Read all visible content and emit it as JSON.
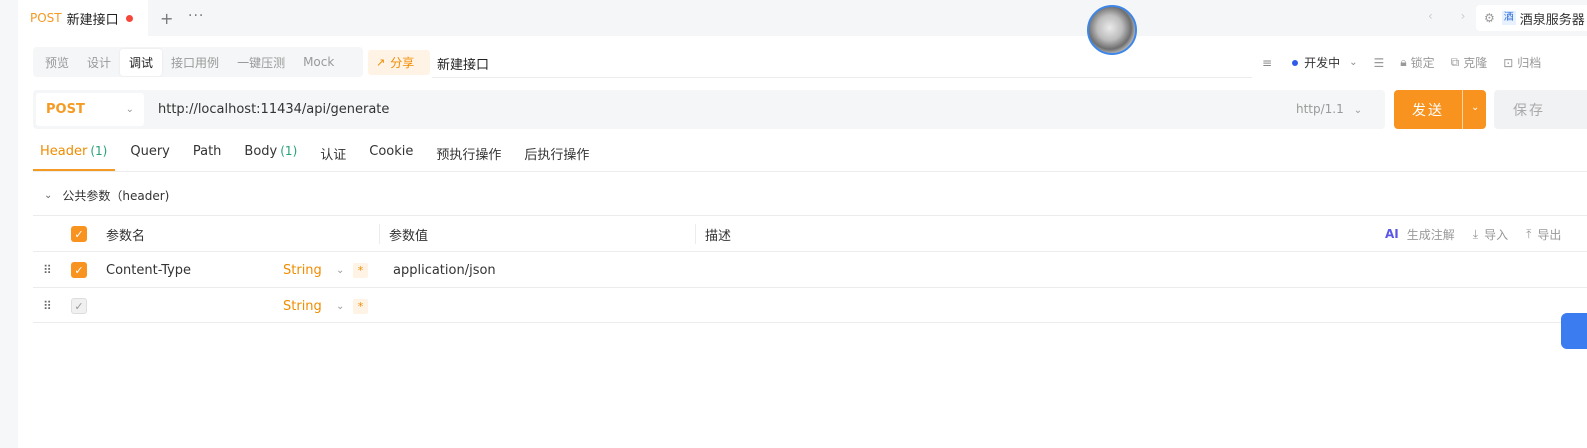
{
  "tabbar": {
    "tab": {
      "method": "POST",
      "title": "新建接口"
    },
    "plus": "+",
    "more": "···",
    "nav_arrows": "‹ ›",
    "project": {
      "icon_char": "酒",
      "name": "酒泉服务器"
    }
  },
  "modes": [
    "预览",
    "设计",
    "调试",
    "接口用例",
    "一键压测",
    "Mock"
  ],
  "active_mode": "调试",
  "share_label": "分享",
  "interface_name": "新建接口",
  "right_tools": {
    "env": "开发中",
    "lock": "锁定",
    "clone": "克隆",
    "archive": "归档"
  },
  "request": {
    "method": "POST",
    "url": "http://localhost:11434/api/generate",
    "http_version": "http/1.1",
    "send_label": "发送",
    "save_label": "保存"
  },
  "param_tabs": [
    {
      "label": "Header",
      "count": "(1)"
    },
    {
      "label": "Query",
      "count": ""
    },
    {
      "label": "Path",
      "count": ""
    },
    {
      "label": "Body",
      "count": "(1)"
    },
    {
      "label": "认证",
      "count": ""
    },
    {
      "label": "Cookie",
      "count": ""
    },
    {
      "label": "预执行操作",
      "count": ""
    },
    {
      "label": "后执行操作",
      "count": ""
    }
  ],
  "common_params": "公共参数（header)",
  "table": {
    "headers": {
      "name": "参数名",
      "value": "参数值",
      "desc": "描述"
    },
    "tools": {
      "ai": "AI",
      "generate": "生成注解",
      "import": "导入",
      "export": "导出"
    },
    "rows": [
      {
        "name": "Content-Type",
        "type": "String",
        "required": "*",
        "value": "application/json",
        "checked": true
      },
      {
        "name": "",
        "type": "String",
        "required": "*",
        "value": "",
        "checked": false
      }
    ]
  },
  "colors": {
    "accent": "#f7931e",
    "count_green": "#26a17b",
    "env_dot": "#2f5bea"
  }
}
